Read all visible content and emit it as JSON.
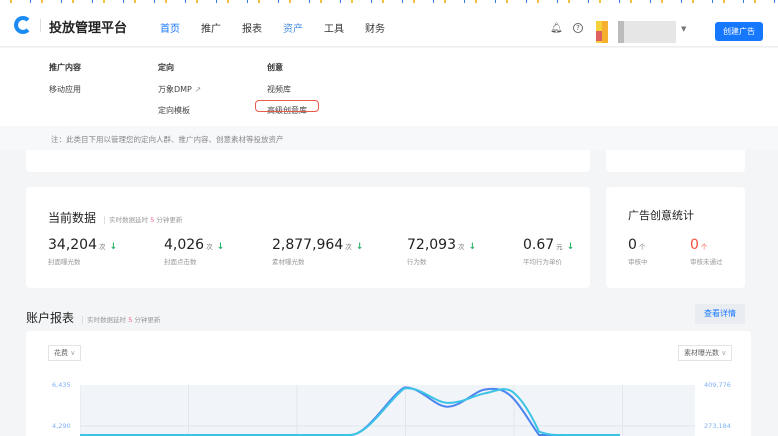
{
  "header": {
    "brand": "投放管理平台",
    "nav": [
      "首页",
      "推广",
      "报表",
      "资产",
      "工具",
      "财务"
    ],
    "create_button": "创建广告"
  },
  "menu": {
    "columns": [
      {
        "title": "推广内容",
        "items": [
          "移动应用"
        ]
      },
      {
        "title": "定向",
        "items": [
          "万象DMP",
          "定向模板"
        ]
      },
      {
        "title": "创意",
        "items": [
          "视频库",
          "高级创意库"
        ]
      }
    ],
    "note": "注：此类目下用以管理您的定向人群、推广内容、创意素材等投放资产"
  },
  "current": {
    "title": "当前数据",
    "sub_prefix": "实时数据延时",
    "sub_num": "5",
    "sub_suffix": "分钟更新",
    "metrics": [
      {
        "value": "34,204",
        "unit": "次",
        "label": "封面曝光数"
      },
      {
        "value": "4,026",
        "unit": "次",
        "label": "封面点击数"
      },
      {
        "value": "2,877,964",
        "unit": "次",
        "label": "素材曝光数"
      },
      {
        "value": "72,093",
        "unit": "次",
        "label": "行为数"
      },
      {
        "value": "0.67",
        "unit": "元",
        "label": "平均行为单价"
      }
    ]
  },
  "creative": {
    "title": "广告创意统计",
    "items": [
      {
        "value": "0",
        "unit": "个",
        "label": "审核中"
      },
      {
        "value": "0",
        "unit": "个",
        "label": "审核未通过"
      }
    ]
  },
  "report": {
    "title": "账户报表",
    "sub_prefix": "实时数据延时",
    "sub_num": "5",
    "sub_suffix": "分钟更新",
    "detail_button": "查看详情",
    "left_select": "花费",
    "right_select": "素材曝光数"
  },
  "chart_data": {
    "type": "line",
    "left_ticks": [
      "6,435",
      "4,290"
    ],
    "right_ticks": [
      "409,776",
      "273,184"
    ],
    "ylim_left": [
      0,
      6435
    ],
    "series": [
      {
        "name": "花费",
        "color": "#4c84f0",
        "x": [
          0,
          1,
          2,
          3,
          4,
          5,
          6,
          6.8,
          7.5,
          8,
          8.5,
          9,
          10
        ],
        "values": [
          0,
          0,
          0,
          0,
          0,
          2000,
          6300,
          5300,
          6200,
          5800,
          3500,
          0,
          0
        ]
      },
      {
        "name": "素材曝光数",
        "color": "#3cc4e6",
        "x": [
          0,
          1,
          2,
          3,
          4,
          5,
          6,
          6.8,
          7.5,
          8,
          8.5,
          9,
          10
        ],
        "values": [
          0,
          0,
          0,
          0,
          0,
          1500,
          6250,
          5500,
          6000,
          6100,
          4000,
          0,
          0
        ]
      }
    ]
  }
}
